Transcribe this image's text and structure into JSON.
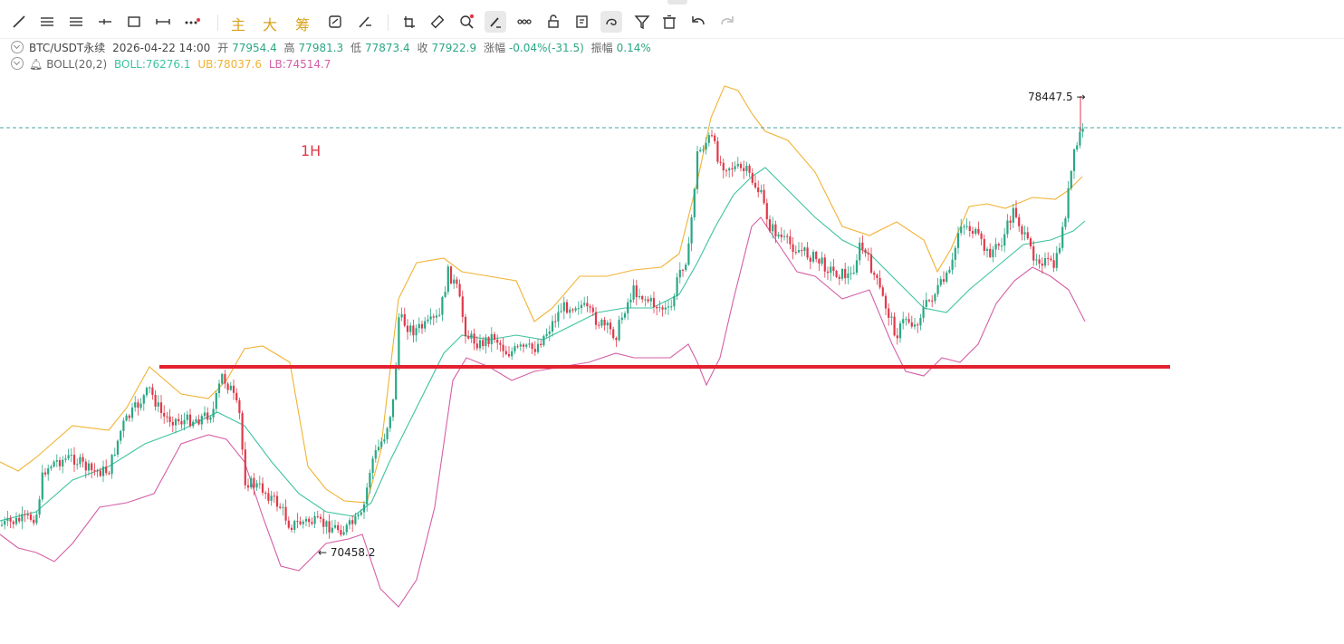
{
  "toolbar": {
    "tools_left": [
      "line-tool-icon",
      "horizontal-ray-icon",
      "parallel-channel-icon",
      "cross-line-icon",
      "rectangle-tool-icon",
      "measure-range-icon",
      "more-tools-icon"
    ],
    "cn_labels": [
      "主",
      "大",
      "筹"
    ],
    "tools_right": [
      "chart-sync-icon",
      "brush-tool-icon",
      "select-rect-icon",
      "ruler-icon",
      "zoom-search-icon",
      "magnet-icon",
      "pattern-tool-icon",
      "lock-icon",
      "template-icon",
      "hide-drawings-icon",
      "filter-icon",
      "delete-icon",
      "undo-icon",
      "redo-icon"
    ]
  },
  "legend": {
    "symbol": "BTC/USDT永续",
    "datetime": "2026-04-22 14:00",
    "open_label": "开",
    "open": "77954.4",
    "high_label": "高",
    "high": "77981.3",
    "low_label": "低",
    "low": "77873.4",
    "close_label": "收",
    "close": "77922.9",
    "change_label": "涨幅",
    "change": "-0.04%(-31.5)",
    "amp_label": "振幅",
    "amp": "0.14%",
    "boll_name": "BOLL(20,2)",
    "boll": "BOLL:76276.1",
    "ub": "UB:78037.6",
    "lb": "LB:74514.7"
  },
  "annotations": {
    "timeframe": "1H",
    "high_mark": "78447.5 →",
    "low_mark": "← 70458.2"
  },
  "colors": {
    "up": "#2aa784",
    "down": "#e0394a",
    "boll_mid": "#3cc3a0",
    "boll_ub": "#f2b233",
    "boll_lb": "#d45fa6",
    "support_line": "#e3212f",
    "price_dash": "#4aa3a0"
  },
  "chart_data": {
    "type": "candlestick",
    "interval": "1H",
    "last_price": 77922.9,
    "support_level": 74500,
    "high_marked": 78447.5,
    "low_marked": 70458.2
  }
}
